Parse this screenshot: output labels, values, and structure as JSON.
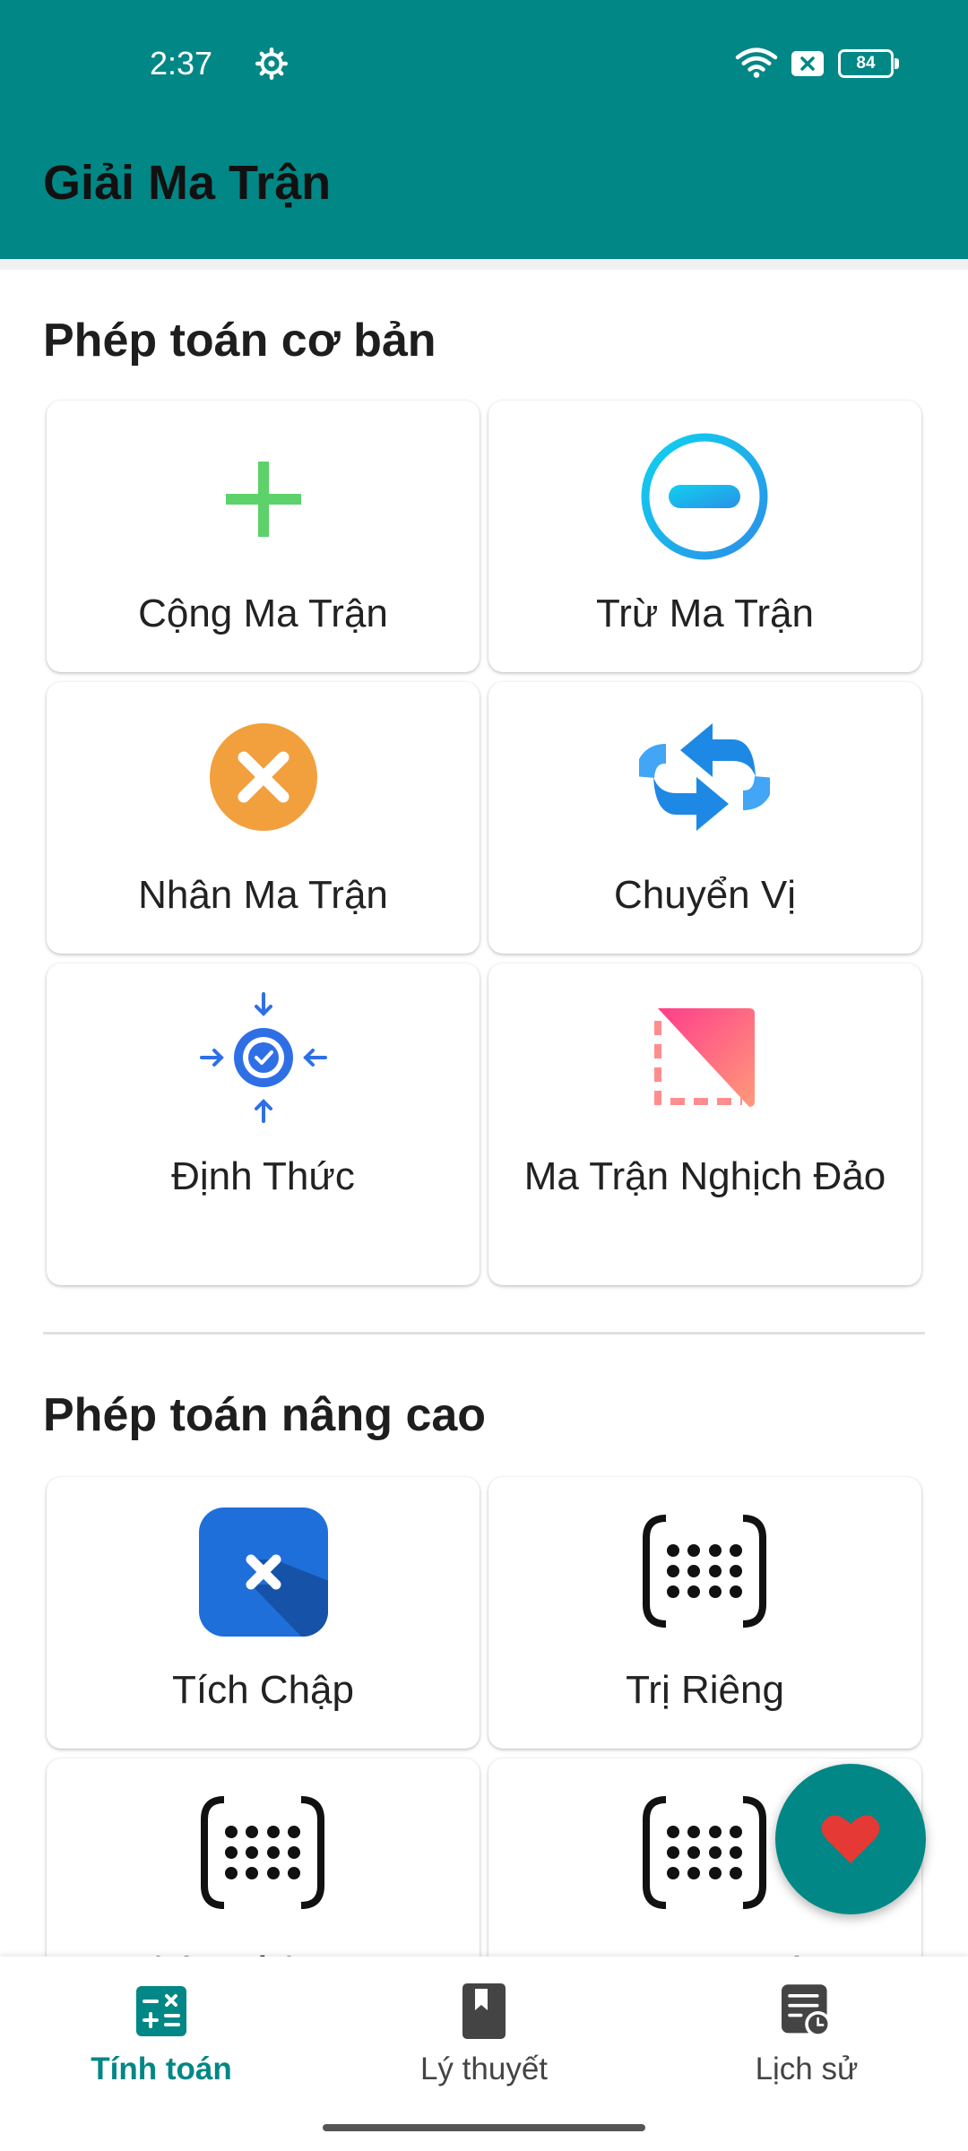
{
  "status_bar": {
    "time": "2:37",
    "battery": "84"
  },
  "app_bar": {
    "title": "Giải Ma Trận"
  },
  "basic_section": {
    "title": "Phép toán cơ bản",
    "items": [
      {
        "label": "Cộng Ma Trận",
        "icon": "plus-icon"
      },
      {
        "label": "Trừ Ma Trận",
        "icon": "minus-circle-icon"
      },
      {
        "label": "Nhân Ma Trận",
        "icon": "multiply-circle-icon"
      },
      {
        "label": "Chuyển Vị",
        "icon": "swap-arrows-icon"
      },
      {
        "label": "Định Thức",
        "icon": "target-icon"
      },
      {
        "label": "Ma Trận Nghịch Đảo",
        "icon": "inverse-square-icon"
      }
    ]
  },
  "advanced_section": {
    "title": "Phép toán nâng cao",
    "items": [
      {
        "label": "Tích Chập",
        "icon": "convolution-icon"
      },
      {
        "label": "Trị Riêng",
        "icon": "matrix-icon"
      },
      {
        "label": "Phân Tích SVD",
        "icon": "matrix-icon"
      },
      {
        "label": "Hạng Ma Trận",
        "icon": "matrix-icon"
      }
    ]
  },
  "fab": {
    "icon": "heart-icon"
  },
  "bottom_nav": {
    "items": [
      {
        "label": "Tính toán",
        "icon": "calculator-icon",
        "active": true
      },
      {
        "label": "Lý thuyết",
        "icon": "book-icon",
        "active": false
      },
      {
        "label": "Lịch sử",
        "icon": "history-icon",
        "active": false
      }
    ]
  },
  "colors": {
    "primary": "#018786",
    "plus": "#5dd16a",
    "minus": "#1ab4ef",
    "multiply": "#f2a03d",
    "swap": "#2a85e0",
    "target": "#2f6fe6",
    "heart": "#e53935"
  }
}
